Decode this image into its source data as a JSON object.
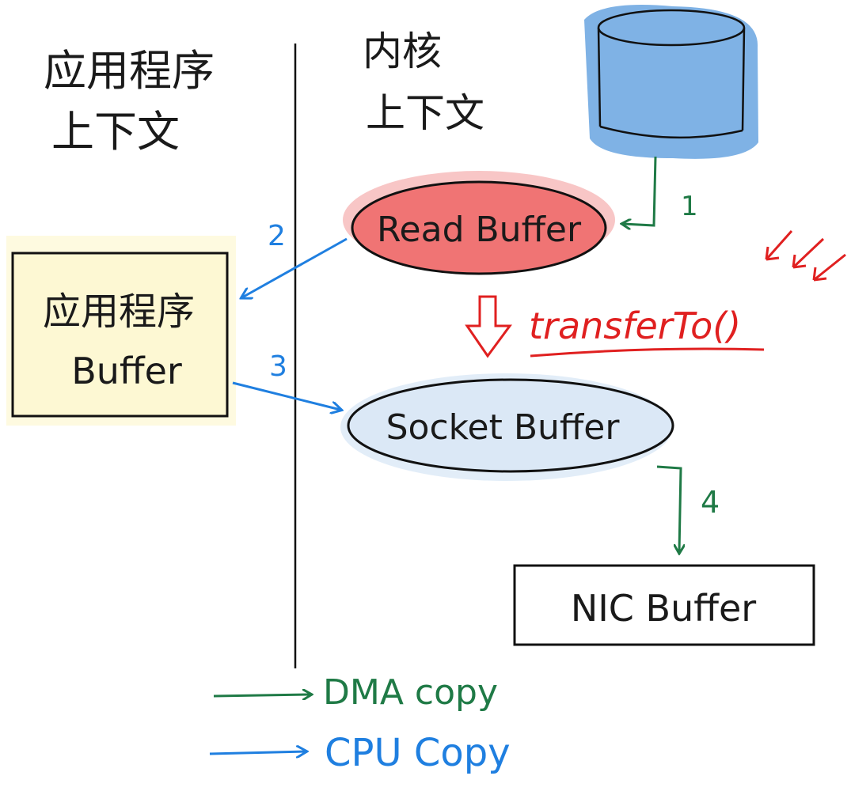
{
  "labels": {
    "app_context_line1": "应用程序",
    "app_context_line2": "上下文",
    "kernel_context_line1": "内核",
    "kernel_context_line2": "上下文",
    "read_buffer": "Read Buffer",
    "app_buffer_line1": "应用程序",
    "app_buffer_line2": "Buffer",
    "socket_buffer": "Socket Buffer",
    "nic_buffer": "NIC Buffer",
    "transfer": "transferTo()"
  },
  "steps": {
    "s1": "1",
    "s2": "2",
    "s3": "3",
    "s4": "4"
  },
  "legend": {
    "dma": "DMA copy",
    "cpu": "CPU Copy"
  },
  "colors": {
    "dma": "#1f7a46",
    "cpu": "#1f7fe0",
    "highlight": "#e02020",
    "disk": "#7fb2e5",
    "read_buffer_fill": "#f07474",
    "socket_buffer_fill": "#dbe8f6",
    "app_buffer_fill": "#fdf8d3"
  }
}
